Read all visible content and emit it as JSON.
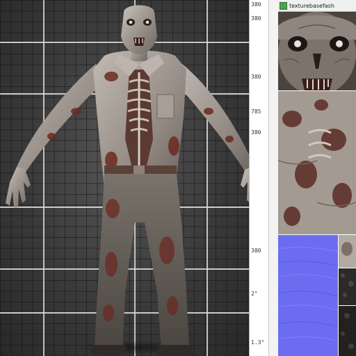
{
  "viewport": {
    "label": "3D model viewport",
    "character": "zombie-character"
  },
  "ruler": {
    "labels": [
      "380",
      "380",
      "380",
      "785",
      "380",
      "380",
      "2°",
      "1.3°"
    ]
  },
  "texture_panel": {
    "tab_label": "texturebasefash",
    "tiles": [
      "face-texture",
      "body-texture",
      "normal-map",
      "detail-texture",
      "dark-texture-1",
      "dark-texture-2"
    ]
  },
  "colors": {
    "grid_bg": "#3a3a3a",
    "grid_major": "#dcdcdc",
    "normal_map": "#6c6cf0",
    "skin": "#a59f98",
    "blood": "#6b2a22"
  }
}
